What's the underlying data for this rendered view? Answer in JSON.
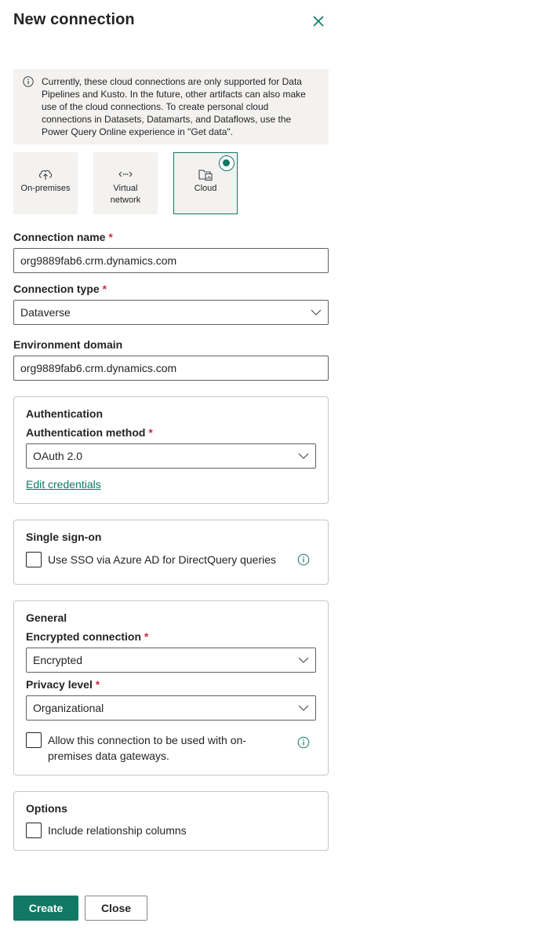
{
  "dialog": {
    "title": "New connection",
    "close_icon": "close-icon"
  },
  "info": {
    "text": "Currently, these cloud connections are only supported for Data Pipelines and Kusto. In the future, other artifacts can also make use of the cloud connections. To create personal cloud connections in Datasets, Datamarts, and Dataflows, use the Power Query Online experience in \"Get data\"."
  },
  "tiles": [
    {
      "label": "On-premises",
      "icon": "cloud-upload-icon",
      "selected": false
    },
    {
      "label": "Virtual network",
      "icon": "network-icon",
      "selected": false
    },
    {
      "label": "Cloud",
      "icon": "folder-chart-icon",
      "selected": true
    }
  ],
  "connection_name": {
    "label": "Connection name",
    "required": "*",
    "value": "org9889fab6.crm.dynamics.com"
  },
  "connection_type": {
    "label": "Connection type",
    "required": "*",
    "value": "Dataverse"
  },
  "environment_domain": {
    "label": "Environment domain",
    "value": "org9889fab6.crm.dynamics.com"
  },
  "authentication": {
    "title": "Authentication",
    "method_label": "Authentication method",
    "required": "*",
    "method_value": "OAuth 2.0",
    "edit_link": "Edit credentials"
  },
  "sso": {
    "title": "Single sign-on",
    "checkbox_label": "Use SSO via Azure AD for DirectQuery queries",
    "checked": false
  },
  "general": {
    "title": "General",
    "encrypted_label": "Encrypted connection",
    "encrypted_value": "Encrypted",
    "privacy_label": "Privacy level",
    "privacy_value": "Organizational",
    "required": "*",
    "gateway_label": "Allow this connection to be used with on-premises data gateways.",
    "gateway_checked": false
  },
  "options": {
    "title": "Options",
    "relationship_label": "Include relationship columns",
    "relationship_checked": false
  },
  "buttons": {
    "create": "Create",
    "close": "Close"
  },
  "colors": {
    "accent": "#117865",
    "required": "#c4314b",
    "info_bg": "#f3f2f1"
  }
}
